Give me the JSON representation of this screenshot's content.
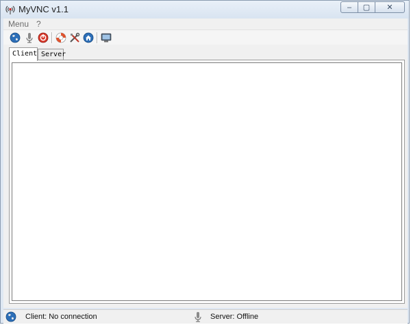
{
  "window": {
    "title": "MyVNC v1.1",
    "controls": {
      "minimize": "‒",
      "maximize": "▢",
      "close": "✕"
    }
  },
  "menubar": {
    "items": [
      "Menu",
      "?"
    ]
  },
  "toolbar": {
    "buttons": [
      {
        "icon": "globe-icon"
      },
      {
        "icon": "microphone-icon"
      },
      {
        "icon": "stop-icon"
      },
      {
        "icon": "lifebuoy-icon"
      },
      {
        "icon": "tools-icon"
      },
      {
        "icon": "home-icon"
      },
      {
        "icon": "monitor-icon"
      }
    ]
  },
  "tabs": [
    {
      "label": "Client",
      "active": true
    },
    {
      "label": "Server",
      "active": false
    }
  ],
  "status": {
    "client": "Client: No connection",
    "server": "Server: Offline"
  },
  "colors": {
    "window_frame": "#dfe8f3",
    "panel": "#f0f0f0",
    "accent_blue": "#2d6fb8",
    "stop_red": "#d83a2c"
  }
}
